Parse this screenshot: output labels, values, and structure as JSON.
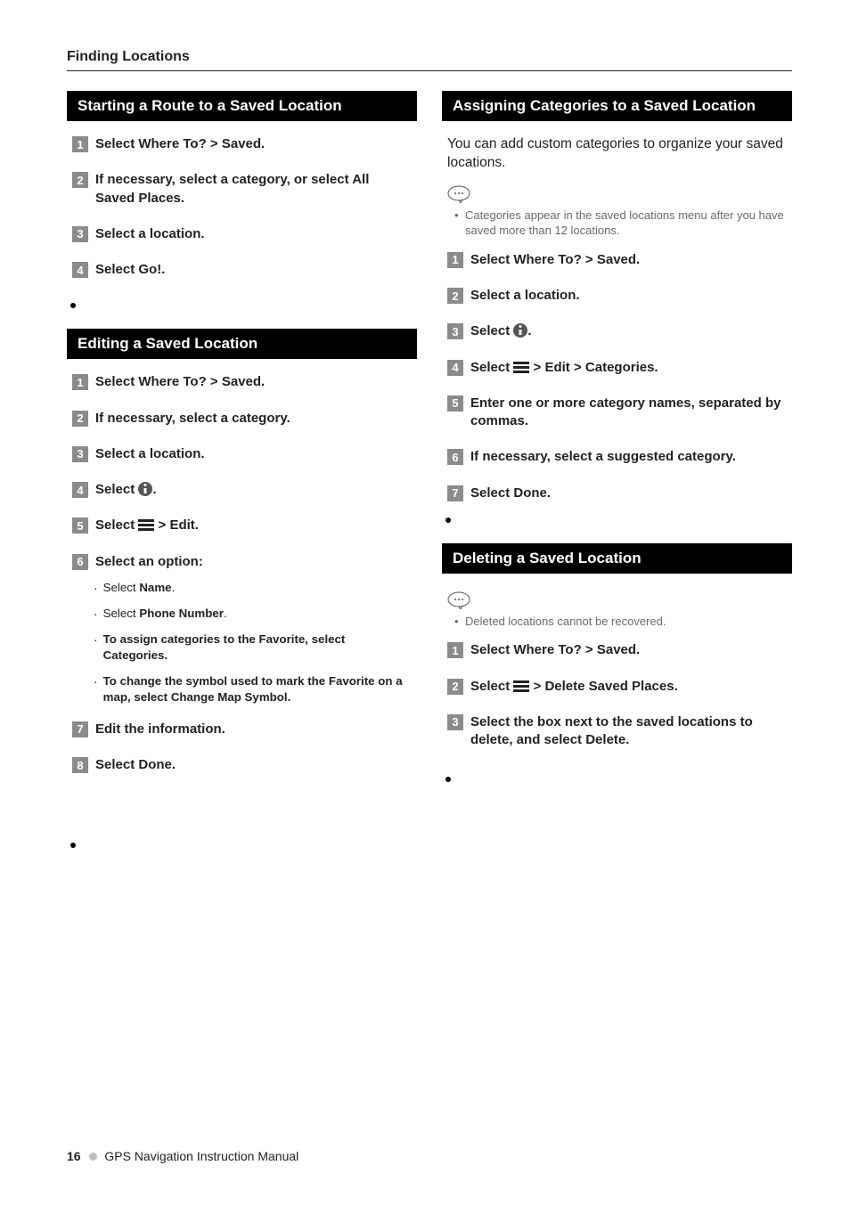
{
  "header": "Finding Locations",
  "left": {
    "sec1": {
      "title": "Starting a Route to a Saved Location",
      "steps": {
        "s1": "Select Where To? > Saved.",
        "s2": "If necessary, select a category, or select All Saved Places.",
        "s3": "Select a location.",
        "s4": "Select Go!."
      }
    },
    "sec2": {
      "title": "Editing a Saved Location",
      "steps": {
        "s1": "Select Where To? > Saved.",
        "s2": "If necessary, select a category.",
        "s3": "Select a location.",
        "s4a": "Select ",
        "s4b": ".",
        "s5a": "Select ",
        "s5b": " > Edit.",
        "s6": "Select an option:",
        "s7": "Edit the information.",
        "s8": "Select Done."
      },
      "opts": {
        "a_pre": "Select ",
        "a_bold": "Name",
        "a_post": ".",
        "b_pre": "Select ",
        "b_bold": "Phone Number",
        "b_post": ".",
        "c_pre": "To assign categories to the Favorite, select ",
        "c_bold": "Categories",
        "c_post": ".",
        "d_pre": "To change the symbol used to mark the Favorite on a map, select ",
        "d_bold": "Change Map Symbol",
        "d_post": "."
      }
    }
  },
  "right": {
    "sec1": {
      "title": "Assigning Categories to a Saved Location",
      "intro": "You can add custom categories to organize your saved locations.",
      "note": "Categories appear in the saved locations menu after you have saved more than 12 locations.",
      "steps": {
        "s1": "Select Where To? > Saved.",
        "s2": "Select a location.",
        "s3a": "Select ",
        "s3b": ".",
        "s4a": "Select ",
        "s4b": " > Edit > Categories.",
        "s5": "Enter one or more category names, separated by commas.",
        "s6": "If necessary, select a suggested category.",
        "s7": "Select Done."
      }
    },
    "sec2": {
      "title": "Deleting a Saved Location",
      "note": "Deleted locations cannot be recovered.",
      "steps": {
        "s1": "Select Where To? > Saved.",
        "s2a": "Select ",
        "s2b": " > Delete Saved Places.",
        "s3": "Select the box next to the saved locations to delete, and select Delete."
      }
    }
  },
  "footer": {
    "page": "16",
    "title": "GPS Navigation Instruction Manual"
  }
}
